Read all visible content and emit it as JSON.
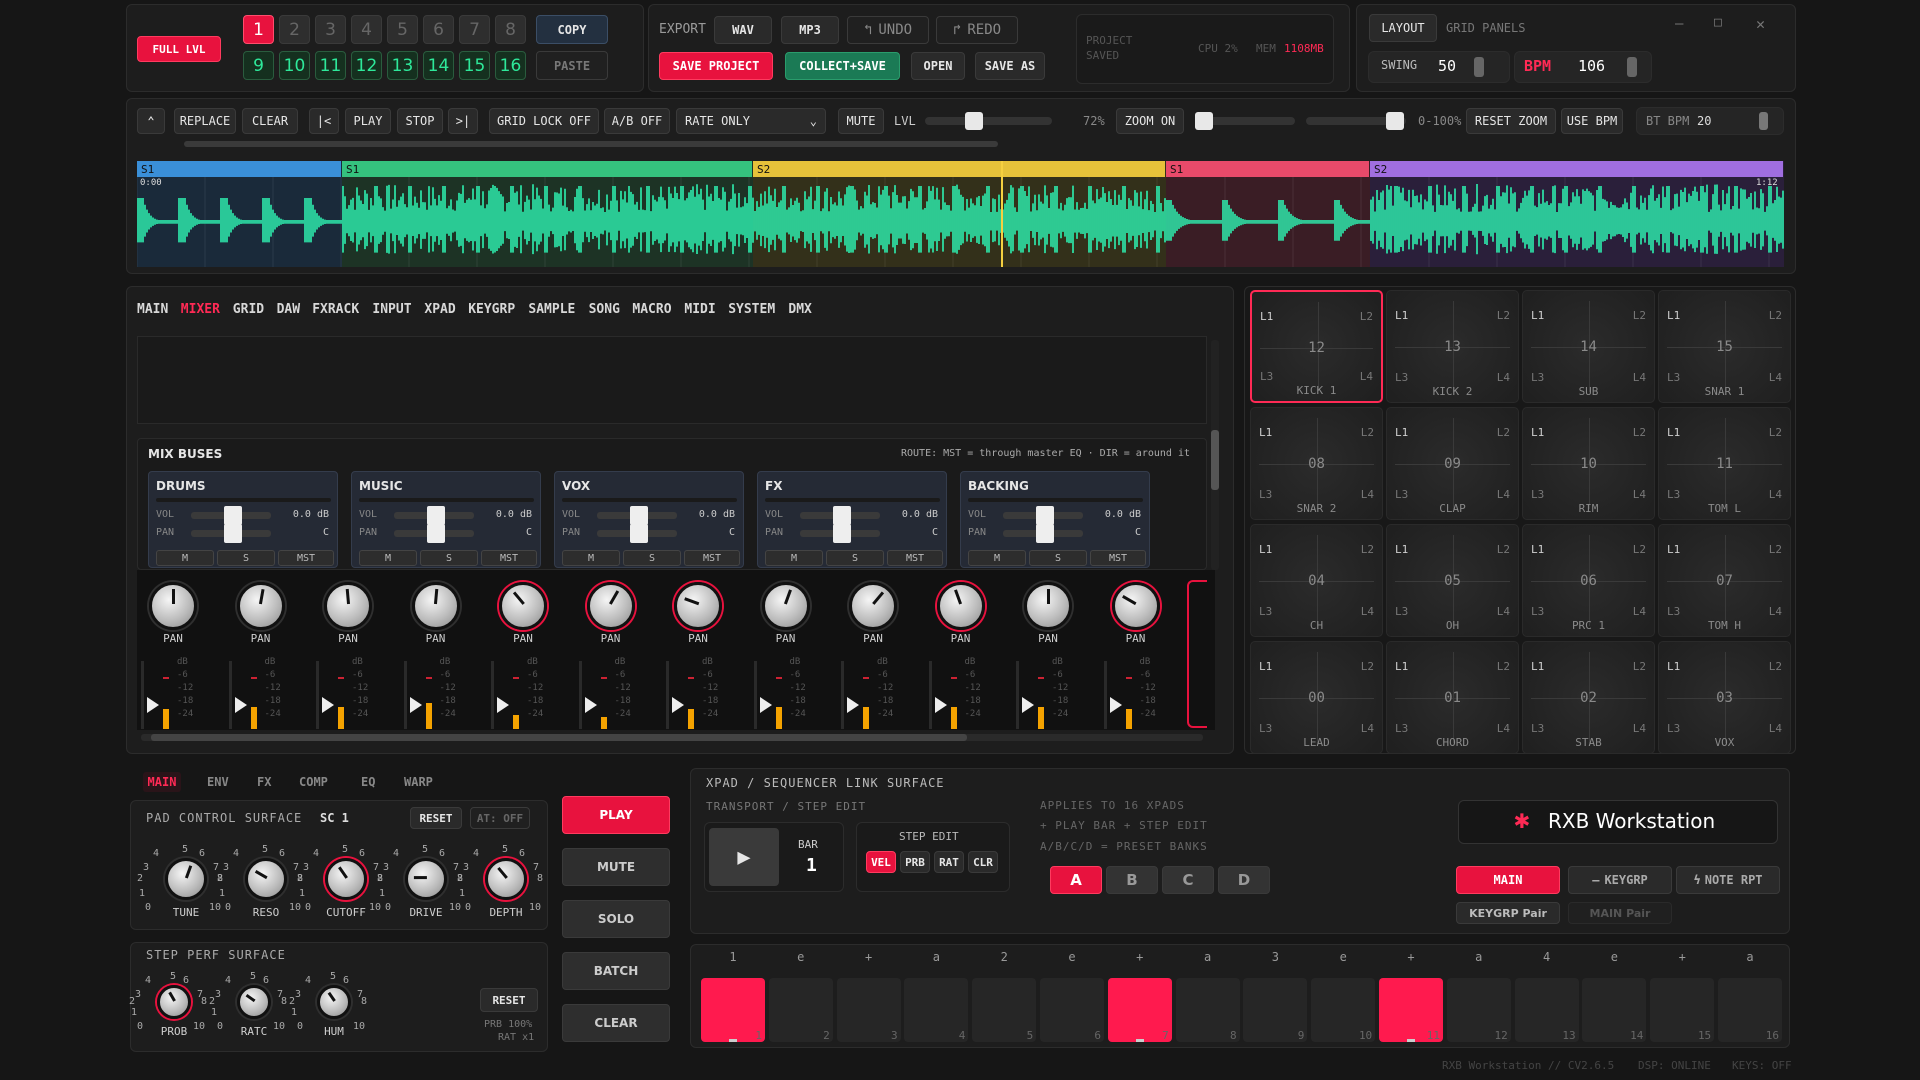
{
  "header": {
    "full_lvl": "FULL LVL",
    "banks_top": [
      "1",
      "2",
      "3",
      "4",
      "5",
      "6",
      "7",
      "8"
    ],
    "banks_bottom": [
      "9",
      "10",
      "11",
      "12",
      "13",
      "14",
      "15",
      "16"
    ],
    "copy": "COPY",
    "paste": "PASTE",
    "export": "EXPORT",
    "wav": "WAV",
    "mp3": "MP3",
    "undo": "UNDO",
    "redo": "REDO",
    "save_project": "SAVE PROJECT",
    "collect_save": "COLLECT+SAVE",
    "open": "OPEN",
    "save_as": "SAVE AS",
    "project_status_1": "PROJECT",
    "project_status_2": "SAVED",
    "cpu": "CPU 2%",
    "mem_label": "MEM",
    "mem_value": "1108MB",
    "layout": "LAYOUT",
    "grid_panels": "GRID PANELS",
    "swing_label": "SWING",
    "swing_value": "50",
    "bpm_label": "BPM",
    "bpm_value": "106"
  },
  "toolbar": {
    "replace": "REPLACE",
    "clear": "CLEAR",
    "start": "|<",
    "play": "PLAY",
    "stop": "STOP",
    "end": ">|",
    "grid_lock": "GRID LOCK OFF",
    "ab": "A/B OFF",
    "rate_only": "RATE ONLY",
    "mute": "MUTE",
    "lvl": "LVL",
    "lvl_pct": "72%",
    "zoom_on": "ZOOM ON",
    "range": "0-100%",
    "reset_zoom": "RESET ZOOM",
    "use_bpm": "USE BPM",
    "bt_bpm": "BT BPM",
    "bt_bpm_value": "20"
  },
  "waveform": {
    "segments": [
      {
        "label": "S1",
        "color": "#3a8fd8"
      },
      {
        "label": "S1",
        "color": "#35c27e"
      },
      {
        "label": "S2",
        "color": "#e6c23a"
      },
      {
        "label": "S1",
        "color": "#e84a6a"
      },
      {
        "label": "S2",
        "color": "#a06ee0"
      }
    ],
    "time_start": "0:00",
    "time_end": "1:12"
  },
  "tabs": [
    "MAIN",
    "MIXER",
    "GRID",
    "DAW",
    "FXRACK",
    "INPUT",
    "XPAD",
    "KEYGRP",
    "SAMPLE",
    "SONG",
    "MACRO",
    "MIDI",
    "SYSTEM",
    "DMX"
  ],
  "mixbuses": {
    "title": "MIX BUSES",
    "route": "ROUTE: MST = through master EQ · DIR = around it",
    "buses": [
      "DRUMS",
      "MUSIC",
      "VOX",
      "FX",
      "BACKING"
    ],
    "vol": "VOL",
    "pan": "PAN",
    "db": "0.0 dB",
    "center": "C",
    "m": "M",
    "s": "S",
    "mst": "MST"
  },
  "channel_pan": "PAN",
  "meter_scale": [
    "dB",
    "-6",
    "-12",
    "-18",
    "-24"
  ],
  "pads": [
    {
      "num": "12",
      "name": "KICK 1"
    },
    {
      "num": "13",
      "name": "KICK 2"
    },
    {
      "num": "14",
      "name": "SUB"
    },
    {
      "num": "15",
      "name": "SNAR 1"
    },
    {
      "num": "08",
      "name": "SNAR 2"
    },
    {
      "num": "09",
      "name": "CLAP"
    },
    {
      "num": "10",
      "name": "RIM"
    },
    {
      "num": "11",
      "name": "TOM L"
    },
    {
      "num": "04",
      "name": "CH"
    },
    {
      "num": "05",
      "name": "OH"
    },
    {
      "num": "06",
      "name": "PRC 1"
    },
    {
      "num": "07",
      "name": "TOM H"
    },
    {
      "num": "00",
      "name": "LEAD"
    },
    {
      "num": "01",
      "name": "CHORD"
    },
    {
      "num": "02",
      "name": "STAB"
    },
    {
      "num": "03",
      "name": "VOX"
    }
  ],
  "pad_corners": {
    "l1": "L1",
    "l2": "L2",
    "l3": "L3",
    "l4": "L4"
  },
  "bottom_tabs": [
    "MAIN",
    "ENV",
    "FX",
    "COMP",
    "EQ",
    "WARP"
  ],
  "pad_control": {
    "title": "PAD CONTROL SURFACE",
    "sc": "SC 1",
    "reset": "RESET",
    "at": "AT: OFF",
    "knobs": [
      "TUNE",
      "RESO",
      "CUTOFF",
      "DRIVE",
      "DEPTH"
    ],
    "scale": [
      "0",
      "1",
      "2",
      "3",
      "4",
      "5",
      "6",
      "7",
      "8",
      "10"
    ]
  },
  "step_perf": {
    "title": "STEP PERF SURFACE",
    "reset": "RESET",
    "prb": "PRB 100%",
    "rat": "RAT x1",
    "knobs": [
      "PROB",
      "RATC",
      "HUM"
    ]
  },
  "transport_buttons": [
    "PLAY",
    "MUTE",
    "SOLO",
    "BATCH",
    "CLEAR"
  ],
  "xpad": {
    "title": "XPAD / SEQUENCER LINK SURFACE",
    "sub": "TRANSPORT / STEP EDIT",
    "bar_label": "BAR",
    "bar_value": "1",
    "step_edit": "STEP EDIT",
    "se_buttons": [
      "VEL",
      "PRB",
      "RAT",
      "CLR"
    ],
    "info1": "APPLIES TO 16 XPADS",
    "info2": "+ PLAY BAR + STEP EDIT",
    "info3": "A/B/C/D = PRESET BANKS",
    "banks": [
      "A",
      "B",
      "C",
      "D"
    ],
    "brand": "RXB Workstation",
    "main": "MAIN",
    "keygrp": "KEYGRP",
    "note_rpt": "NOTE RPT",
    "keygrp_pair": "KEYGRP Pair",
    "main_pair": "MAIN Pair"
  },
  "step_labels": [
    "1",
    "e",
    "+",
    "a",
    "2",
    "e",
    "+",
    "a",
    "3",
    "e",
    "+",
    "a",
    "4",
    "e",
    "+",
    "a"
  ],
  "steps_on": [
    1,
    7,
    11
  ],
  "footer": {
    "version": "RXB Workstation // CV2.6.5",
    "dsp": "DSP: ONLINE",
    "keys": "KEYS: OFF"
  }
}
